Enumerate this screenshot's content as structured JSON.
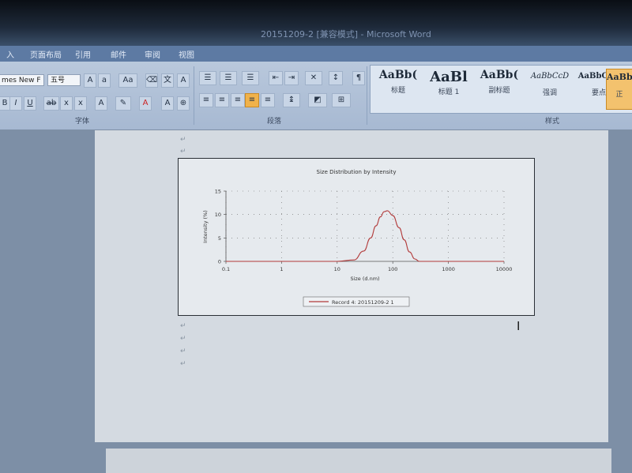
{
  "window": {
    "title": "20151209-2 [兼容模式] - Microsoft Word"
  },
  "menu": {
    "tabs": [
      "入",
      "页面布局",
      "引用",
      "邮件",
      "审阅",
      "视图"
    ]
  },
  "ribbon": {
    "font_name": "mes New F",
    "font_size": "五号",
    "group_font": "字体",
    "group_paragraph": "段落",
    "group_styles": "样式",
    "styles": [
      {
        "sample": "AaBb(",
        "name": "标题"
      },
      {
        "sample": "AaBl",
        "name": "标题 1"
      },
      {
        "sample": "AaBb(",
        "name": "副标题"
      },
      {
        "sample": "AaBbCcD",
        "name": "强调"
      },
      {
        "sample": "AaBbCcD",
        "name": "要点"
      },
      {
        "sample": "AaBbC",
        "name": "正"
      }
    ]
  },
  "chart_data": {
    "type": "line",
    "title": "Size Distribution by Intensity",
    "xlabel": "Size (d.nm)",
    "ylabel": "Intensity (%)",
    "xscale": "log",
    "xlim": [
      0.1,
      10000
    ],
    "ylim": [
      0,
      15
    ],
    "xticks": [
      "0.1",
      "1",
      "10",
      "100",
      "1000",
      "10000"
    ],
    "yticks": [
      "0",
      "5",
      "10",
      "15"
    ],
    "grid": "dotted",
    "legend": "bottom-center",
    "series": [
      {
        "name": "Record 4: 20151209-2 1",
        "color": "#b23a3a",
        "x": [
          0.1,
          1,
          10,
          20,
          30,
          40,
          50,
          60,
          70,
          80,
          100,
          130,
          160,
          200,
          250,
          300,
          1000,
          10000
        ],
        "y": [
          0,
          0,
          0,
          0.3,
          2.2,
          5.0,
          7.6,
          9.5,
          10.6,
          10.8,
          9.8,
          7.2,
          4.6,
          2.0,
          0.5,
          0,
          0,
          0
        ]
      }
    ]
  }
}
